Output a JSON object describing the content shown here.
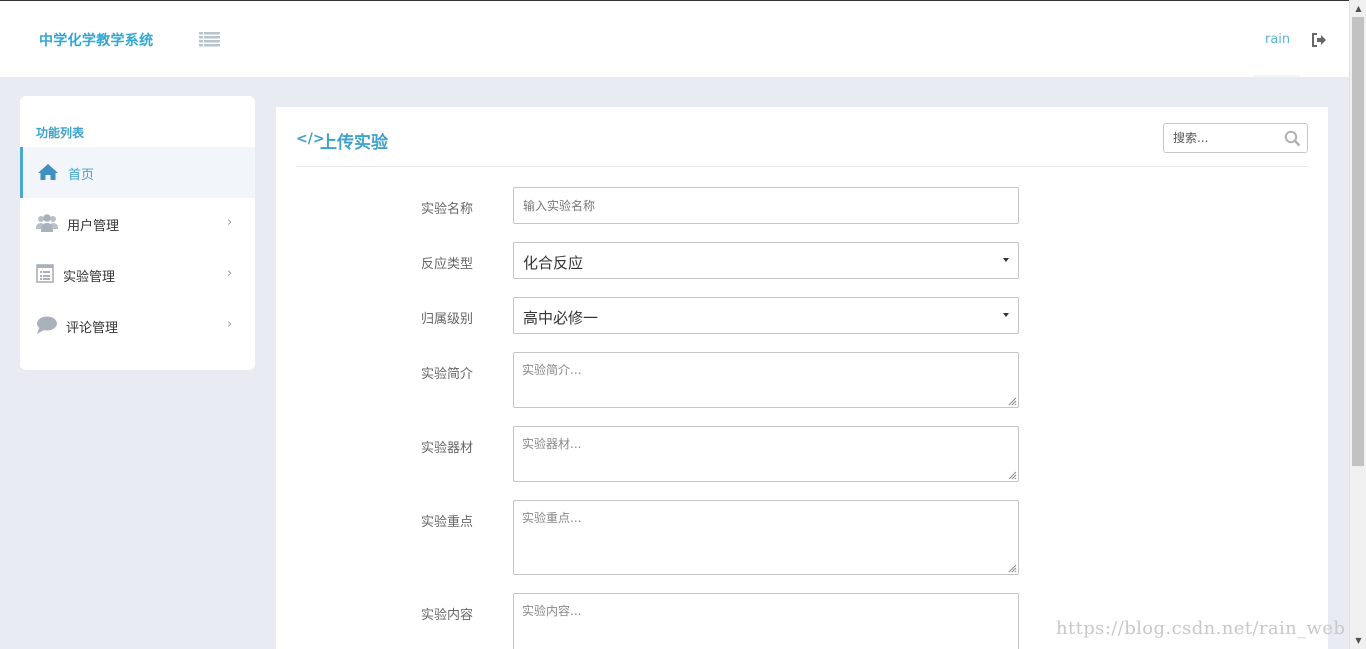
{
  "header": {
    "brand": "中学化学教学系统",
    "user_name": "rain"
  },
  "sidebar": {
    "title": "功能列表",
    "items": [
      {
        "label": "首页",
        "icon": "home-icon",
        "active": true
      },
      {
        "label": "用户管理",
        "icon": "users-icon"
      },
      {
        "label": "实验管理",
        "icon": "list-alt-icon"
      },
      {
        "label": "评论管理",
        "icon": "comment-icon"
      }
    ],
    "chevron": "›"
  },
  "main": {
    "title_icon": "</>",
    "title": "上传实验",
    "search": {
      "placeholder": "搜索..."
    },
    "form": {
      "name": {
        "label": "实验名称",
        "placeholder": "输入实验名称"
      },
      "reaction_type": {
        "label": "反应类型",
        "value": "化合反应"
      },
      "level": {
        "label": "归属级别",
        "value": "高中必修一"
      },
      "intro": {
        "label": "实验简介",
        "placeholder": "实验简介..."
      },
      "equipment": {
        "label": "实验器材",
        "placeholder": "实验器材..."
      },
      "key_points": {
        "label": "实验重点",
        "placeholder": "实验重点..."
      },
      "content": {
        "label": "实验内容",
        "placeholder": "实验内容..."
      }
    }
  },
  "watermark": "https://blog.csdn.net/rain_web",
  "colors": {
    "accent": "#3fa2c9",
    "background": "#e8ebf2",
    "panel": "#ffffff"
  }
}
